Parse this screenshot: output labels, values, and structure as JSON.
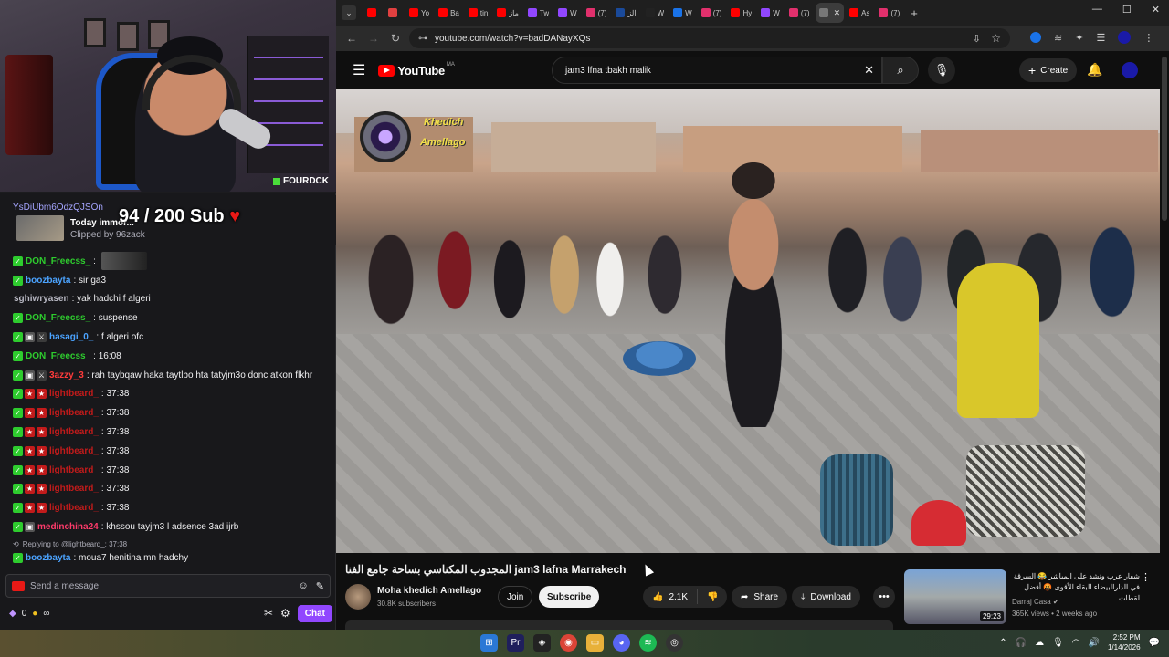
{
  "stream": {
    "webcam_brand": "FOURDCK",
    "clip": {
      "user": "YsDiUbm6OdzQJSOn",
      "title": "Today immor...",
      "by": "Clipped by 96zack"
    },
    "sub_goal": {
      "current": "94",
      "separator": "/",
      "target": "200",
      "label": "Sub",
      "heart": "♥"
    },
    "chat": [
      {
        "user": "DON_Freecss_",
        "color": "#2ecc2e",
        "badges": [
          "green"
        ],
        "text": "",
        "emote": true
      },
      {
        "user": "boozbayta",
        "color": "#4ba3ff",
        "badges": [
          "green"
        ],
        "text": "sir ga3"
      },
      {
        "user": "sghiwryasen",
        "color": "#b9b9c4",
        "badges": [],
        "text": "yak hadchi f algeri"
      },
      {
        "user": "DON_Freecss_",
        "color": "#2ecc2e",
        "badges": [
          "green"
        ],
        "text": "suspense"
      },
      {
        "user": "hasagi_0_",
        "color": "#4ba3ff",
        "badges": [
          "green",
          "grey",
          "mod"
        ],
        "text": "f algeri ofc"
      },
      {
        "user": "DON_Freecss_",
        "color": "#2ecc2e",
        "badges": [
          "green"
        ],
        "text": "16:08"
      },
      {
        "user": "3azzy_3",
        "color": "#ff3b3b",
        "badges": [
          "green",
          "grey",
          "mod"
        ],
        "text": "rah taybqaw haka taytlbo hta tatyjm3o donc atkon flkhr"
      },
      {
        "user": "lightbeard_",
        "color": "#c21b1b",
        "badges": [
          "green",
          "red",
          "red"
        ],
        "text": "37:38"
      },
      {
        "user": "lightbeard_",
        "color": "#c21b1b",
        "badges": [
          "green",
          "red",
          "red"
        ],
        "text": "37:38"
      },
      {
        "user": "lightbeard_",
        "color": "#c21b1b",
        "badges": [
          "green",
          "red",
          "red"
        ],
        "text": "37:38"
      },
      {
        "user": "lightbeard_",
        "color": "#c21b1b",
        "badges": [
          "green",
          "red",
          "red"
        ],
        "text": "37:38"
      },
      {
        "user": "lightbeard_",
        "color": "#c21b1b",
        "badges": [
          "green",
          "red",
          "red"
        ],
        "text": "37:38"
      },
      {
        "user": "lightbeard_",
        "color": "#c21b1b",
        "badges": [
          "green",
          "red",
          "red"
        ],
        "text": "37:38"
      },
      {
        "user": "lightbeard_",
        "color": "#c21b1b",
        "badges": [
          "green",
          "red",
          "red"
        ],
        "text": "37:38"
      },
      {
        "user": "medinchina24",
        "color": "#ff3b6b",
        "badges": [
          "green",
          "grey"
        ],
        "text": "khssou tayjm3 l adsence 3ad ijrb"
      }
    ],
    "reply": {
      "label": "Replying to @lightbeard_: 37:38",
      "user": "boozbayta",
      "color": "#4ba3ff",
      "text": "moua7 henitina mn hadchy"
    },
    "input_placeholder": "Send a message",
    "points": "0",
    "infinity": "∞",
    "chat_button": "Chat"
  },
  "browser": {
    "tabs": [
      {
        "label": "",
        "color": "#ff0000"
      },
      {
        "label": "",
        "color": "#e04040"
      },
      {
        "label": "Yo",
        "color": "#ff0000"
      },
      {
        "label": "Ba",
        "color": "#ff0000"
      },
      {
        "label": "tin",
        "color": "#ff0000"
      },
      {
        "label": "ماز",
        "color": "#ff0000"
      },
      {
        "label": "Tw",
        "color": "#9147ff"
      },
      {
        "label": "W",
        "color": "#9147ff"
      },
      {
        "label": "(7)",
        "color": "#e1306c"
      },
      {
        "label": "الز",
        "color": "#1a4a9a"
      },
      {
        "label": "W",
        "color": "#222222"
      },
      {
        "label": "W",
        "color": "#1a73e8"
      },
      {
        "label": "(7)",
        "color": "#e1306c"
      },
      {
        "label": "Hy",
        "color": "#ff0000"
      },
      {
        "label": "W",
        "color": "#9147ff"
      },
      {
        "label": "(7)",
        "color": "#e1306c"
      },
      {
        "label": "",
        "color": "#777777",
        "active": true
      },
      {
        "label": "As",
        "color": "#ff0000"
      },
      {
        "label": "(7)",
        "color": "#e1306c"
      }
    ],
    "url": "youtube.com/watch?v=badDANayXQs"
  },
  "youtube": {
    "logo": "YouTube",
    "region": "MA",
    "search_query": "jam3 lfna tbakh malik",
    "create_label": "Create",
    "watermark": {
      "line1": "Khedich",
      "line2": "Amellago"
    },
    "video_title": "المجدوب المكناسي بساحة جامع الفنا jam3 lafna Marrakech",
    "channel": "Moha khedich Amellago",
    "subscribers": "30.8K subscribers",
    "join": "Join",
    "subscribe": "Subscribe",
    "likes": "2.1K",
    "share": "Share",
    "download": "Download",
    "recommendation": {
      "title": "شفار عرب وتشد على المباشر 😂 السرقة في الدارالبيضاء البقاء للأقوى 🤬 أفضل لقطات",
      "channel": "Darraj Casa",
      "meta": "365K views • 2 weeks ago",
      "duration": "29:23"
    }
  },
  "taskbar": {
    "time": "2:52 PM",
    "date": "1/14/2026"
  }
}
